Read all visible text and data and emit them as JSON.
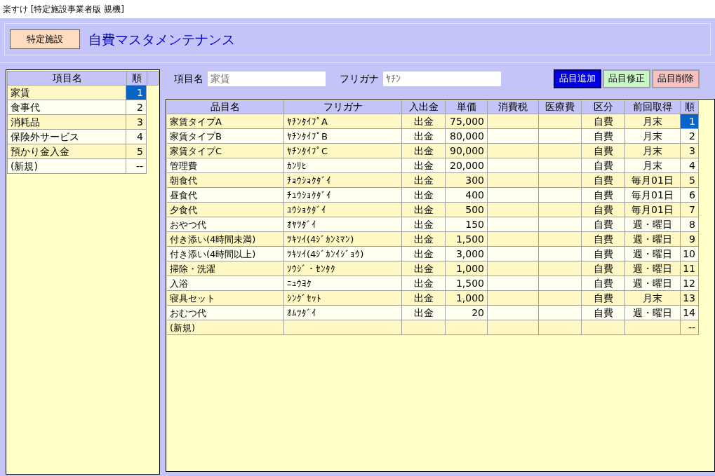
{
  "window": {
    "title": "楽すけ [特定施設事業者版 親機]"
  },
  "header": {
    "badge": "特定施設",
    "heading": "自費マスタメンテナンス"
  },
  "category_list": {
    "columns": [
      "項目名",
      "順"
    ],
    "rows": [
      {
        "name": "家賃",
        "order": "1",
        "selected": true
      },
      {
        "name": "食事代",
        "order": "2",
        "selected": false
      },
      {
        "name": "消耗品",
        "order": "3",
        "selected": false
      },
      {
        "name": "保険外サービス",
        "order": "4",
        "selected": false
      },
      {
        "name": "預かり金入金",
        "order": "5",
        "selected": false
      },
      {
        "name": "(新規)",
        "order": "--",
        "selected": false
      }
    ]
  },
  "form": {
    "fields": [
      {
        "label": "項目名",
        "value": "家賃"
      },
      {
        "label": "フリガナ",
        "value": "ﾔﾁﾝ"
      }
    ],
    "buttons": [
      {
        "label": "品目追加",
        "kind": "add"
      },
      {
        "label": "品目修正",
        "kind": "edit"
      },
      {
        "label": "品目削除",
        "kind": "delete"
      }
    ]
  },
  "items_table": {
    "columns": [
      "品目名",
      "フリガナ",
      "入出金",
      "単価",
      "消費税",
      "医療費",
      "区分",
      "前回取得",
      "順"
    ],
    "rows": [
      {
        "cells": [
          "家賃タイプA",
          "ﾔﾁﾝﾀｲﾌﾟA",
          "出金",
          "75,000",
          "",
          "",
          "自費",
          "月末",
          "1"
        ],
        "selected": true
      },
      {
        "cells": [
          "家賃タイプB",
          "ﾔﾁﾝﾀｲﾌﾟB",
          "出金",
          "80,000",
          "",
          "",
          "自費",
          "月末",
          "2"
        ],
        "selected": false
      },
      {
        "cells": [
          "家賃タイプC",
          "ﾔﾁﾝﾀｲﾌﾟC",
          "出金",
          "90,000",
          "",
          "",
          "自費",
          "月末",
          "3"
        ],
        "selected": false
      },
      {
        "cells": [
          "管理費",
          "ｶﾝﾘﾋ",
          "出金",
          "20,000",
          "",
          "",
          "自費",
          "月末",
          "4"
        ],
        "selected": false
      },
      {
        "cells": [
          "朝食代",
          "ﾁｮｳｼｮｸﾀﾞｲ",
          "出金",
          "300",
          "",
          "",
          "自費",
          "毎月01日",
          "5"
        ],
        "selected": false
      },
      {
        "cells": [
          "昼食代",
          "ﾁｭｳｼｮｸﾀﾞｲ",
          "出金",
          "400",
          "",
          "",
          "自費",
          "毎月01日",
          "6"
        ],
        "selected": false
      },
      {
        "cells": [
          "夕食代",
          "ﾕｳｼｮｸﾀﾞｲ",
          "出金",
          "500",
          "",
          "",
          "自費",
          "毎月01日",
          "7"
        ],
        "selected": false
      },
      {
        "cells": [
          "おやつ代",
          "ｵﾔﾂﾀﾞｲ",
          "出金",
          "150",
          "",
          "",
          "自費",
          "週・曜日",
          "8"
        ],
        "selected": false
      },
      {
        "cells": [
          "付き添い(4時間未満)",
          "ﾂｷｿｲ(4ｼﾞｶﾝﾐﾏﾝ)",
          "出金",
          "1,500",
          "",
          "",
          "自費",
          "週・曜日",
          "9"
        ],
        "selected": false
      },
      {
        "cells": [
          "付き添い(4時間以上)",
          "ﾂｷｿｲ(4ｼﾞｶﾝｲｼﾞｮｳ)",
          "出金",
          "3,000",
          "",
          "",
          "自費",
          "週・曜日",
          "10"
        ],
        "selected": false
      },
      {
        "cells": [
          "掃除・洗濯",
          "ｿｳｼﾞ・ｾﾝﾀｸ",
          "出金",
          "1,000",
          "",
          "",
          "自費",
          "週・曜日",
          "11"
        ],
        "selected": false
      },
      {
        "cells": [
          "入浴",
          "ﾆｭｳﾖｸ",
          "出金",
          "1,500",
          "",
          "",
          "自費",
          "週・曜日",
          "12"
        ],
        "selected": false
      },
      {
        "cells": [
          "寝具セット",
          "ｼﾝｸﾞｾｯﾄ",
          "出金",
          "1,000",
          "",
          "",
          "自費",
          "月末",
          "13"
        ],
        "selected": false
      },
      {
        "cells": [
          "おむつ代",
          "ｵﾑﾂﾀﾞｲ",
          "出金",
          "20",
          "",
          "",
          "自費",
          "週・曜日",
          "14"
        ],
        "selected": false
      },
      {
        "cells": [
          "(新規)",
          "",
          "",
          "",
          "",
          "",
          "",
          "",
          "--"
        ],
        "selected": false
      }
    ]
  }
}
